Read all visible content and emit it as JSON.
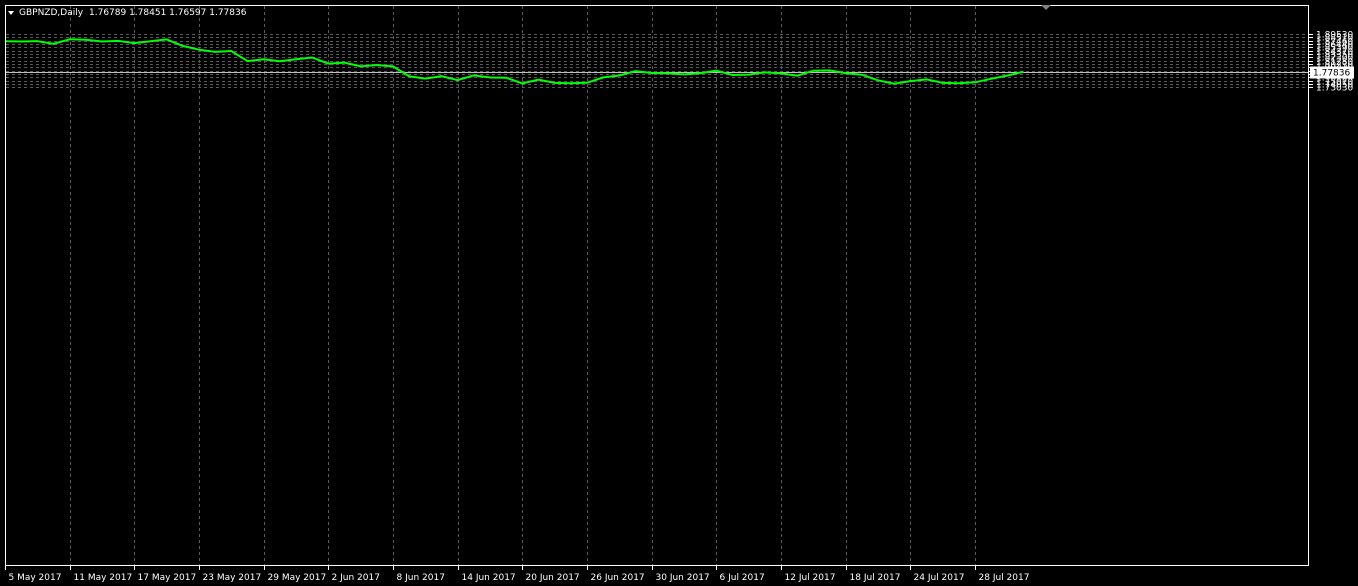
{
  "chart_header": {
    "symbol_timeframe": "GBPNZD,Daily",
    "ohlc": "1.76789 1.78451 1.76597 1.77836"
  },
  "colors": {
    "background": "#000000",
    "grid": "#5a5a5a",
    "line": "#00ff00",
    "axis_text": "#ffffff",
    "current_price_line": "#c0c0c0",
    "current_price_label_bg": "#ffffff",
    "current_price_label_text": "#000000"
  },
  "chart_data": {
    "type": "line",
    "title": "GBPNZD,Daily",
    "xlabel": "",
    "ylabel": "",
    "ylim": [
      1.7303,
      1.9006
    ],
    "grid": true,
    "y_ticks": [
      "1.89530",
      "1.88510",
      "1.87460",
      "1.86440",
      "1.85390",
      "1.84370",
      "1.83350",
      "1.82300",
      "1.81280",
      "1.80230",
      "1.79210",
      "1.78190",
      "1.77140",
      "1.76120",
      "1.75070",
      "1.74050",
      "1.73030"
    ],
    "x_ticks": [
      "5 May 2017",
      "11 May 2017",
      "17 May 2017",
      "23 May 2017",
      "29 May 2017",
      "2 Jun 2017",
      "8 Jun 2017",
      "14 Jun 2017",
      "20 Jun 2017",
      "26 Jun 2017",
      "30 Jun 2017",
      "6 Jul 2017",
      "12 Jul 2017",
      "18 Jul 2017",
      "24 Jul 2017",
      "28 Jul 2017"
    ],
    "current_price": "1.77836",
    "series": [
      {
        "points": [
          [
            "2017-05-04",
            1.8725
          ],
          [
            "2017-05-05",
            1.8718
          ],
          [
            "2017-05-08",
            1.8733
          ],
          [
            "2017-05-09",
            1.8648
          ],
          [
            "2017-05-10",
            1.8787
          ],
          [
            "2017-05-11",
            1.8776
          ],
          [
            "2017-05-12",
            1.8718
          ],
          [
            "2017-05-15",
            1.8737
          ],
          [
            "2017-05-16",
            1.8669
          ],
          [
            "2017-05-17",
            1.8727
          ],
          [
            "2017-05-18",
            1.8783
          ],
          [
            "2017-05-19",
            1.8584
          ],
          [
            "2017-05-22",
            1.8465
          ],
          [
            "2017-05-23",
            1.8398
          ],
          [
            "2017-05-24",
            1.8425
          ],
          [
            "2017-05-25",
            1.8114
          ],
          [
            "2017-05-26",
            1.817
          ],
          [
            "2017-05-29",
            1.8107
          ],
          [
            "2017-05-30",
            1.8173
          ],
          [
            "2017-05-31",
            1.8225
          ],
          [
            "2017-06-01",
            1.8037
          ],
          [
            "2017-06-02",
            1.8068
          ],
          [
            "2017-06-05",
            1.7951
          ],
          [
            "2017-06-06",
            1.7995
          ],
          [
            "2017-06-07",
            1.7952
          ],
          [
            "2017-06-08",
            1.7646
          ],
          [
            "2017-06-09",
            1.7574
          ],
          [
            "2017-06-12",
            1.765
          ],
          [
            "2017-06-13",
            1.7528
          ],
          [
            "2017-06-14",
            1.7673
          ],
          [
            "2017-06-15",
            1.7608
          ],
          [
            "2017-06-16",
            1.7602
          ],
          [
            "2017-06-19",
            1.7426
          ],
          [
            "2017-06-20",
            1.7542
          ],
          [
            "2017-06-21",
            1.7441
          ],
          [
            "2017-06-22",
            1.7428
          ],
          [
            "2017-06-23",
            1.7446
          ],
          [
            "2017-06-26",
            1.7612
          ],
          [
            "2017-06-27",
            1.7671
          ],
          [
            "2017-06-28",
            1.7804
          ],
          [
            "2017-06-29",
            1.7748
          ],
          [
            "2017-06-30",
            1.7734
          ],
          [
            "2017-07-03",
            1.7704
          ],
          [
            "2017-07-04",
            1.7741
          ],
          [
            "2017-07-05",
            1.7818
          ],
          [
            "2017-07-06",
            1.7687
          ],
          [
            "2017-07-07",
            1.7697
          ],
          [
            "2017-07-10",
            1.7767
          ],
          [
            "2017-07-11",
            1.7734
          ],
          [
            "2017-07-12",
            1.7664
          ],
          [
            "2017-07-13",
            1.7818
          ],
          [
            "2017-07-14",
            1.7829
          ],
          [
            "2017-07-17",
            1.774
          ],
          [
            "2017-07-18",
            1.7696
          ],
          [
            "2017-07-19",
            1.7523
          ],
          [
            "2017-07-20",
            1.7416
          ],
          [
            "2017-07-21",
            1.7497
          ],
          [
            "2017-07-24",
            1.7549
          ],
          [
            "2017-07-25",
            1.7441
          ],
          [
            "2017-07-26",
            1.7431
          ],
          [
            "2017-07-27",
            1.746
          ],
          [
            "2017-07-28",
            1.7568
          ],
          [
            "2017-07-31",
            1.7671
          ],
          [
            "2017-08-01",
            1.7784
          ]
        ]
      }
    ]
  }
}
